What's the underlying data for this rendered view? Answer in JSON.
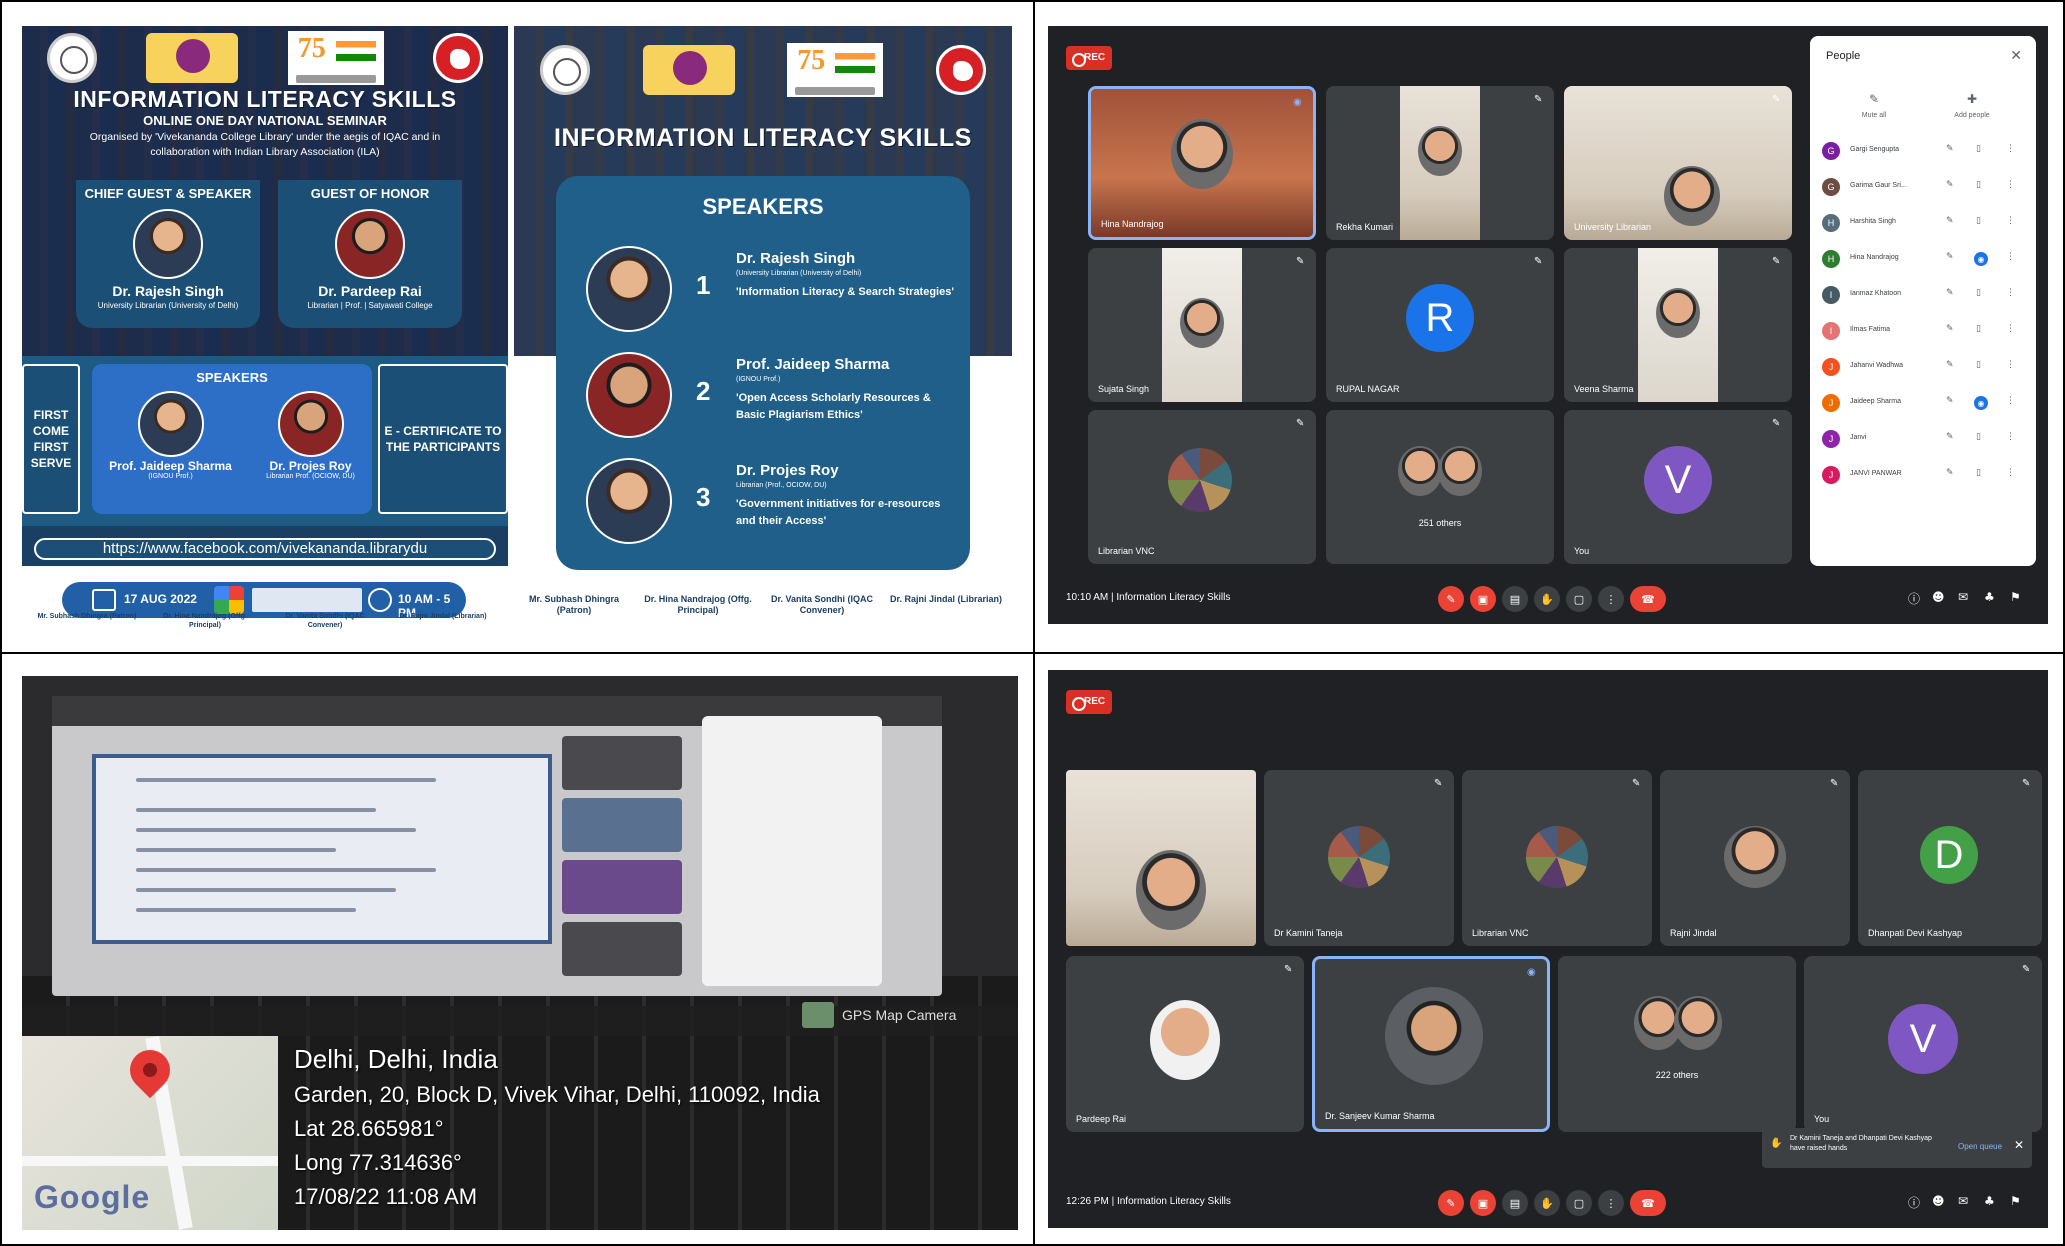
{
  "poster1": {
    "title": "INFORMATION LITERACY SKILLS",
    "subtitle": "ONLINE ONE DAY NATIONAL SEMINAR",
    "organised": "Organised by 'Vivekananda College Library' under the aegis of IQAC and in collaboration with Indian Library Association (ILA)",
    "chief_guest_heading": "CHIEF GUEST & SPEAKER",
    "chief_guest_name": "Dr. Rajesh Singh",
    "chief_guest_desc": "University Librarian (University of Delhi)",
    "guest_honor_heading": "GUEST OF HONOR",
    "guest_honor_name": "Dr. Pardeep Rai",
    "guest_honor_desc": "Librarian | Prof. | Satyawati College",
    "first_come": "FIRST COME FIRST SERVE",
    "speakers_heading": "SPEAKERS",
    "speaker1_name": "Prof. Jaideep Sharma",
    "speaker1_desc": "(IGNOU Prof.)",
    "speaker2_name": "Dr. Projes Roy",
    "speaker2_desc": "Librarian Prof. (OCIOW, DU)",
    "ecert": "E - CERTIFICATE TO THE PARTICIPANTS",
    "fb_link": "https://www.facebook.com/vivekananda.librarydu",
    "date": "17 AUG 2022",
    "time": "10 AM - 5 PM",
    "sign1": "Mr. Subhash Dhingra (Patron)",
    "sign2": "Dr. Hina Nandrajog (Offg. Principal)",
    "sign3": "Dr. Vanita Sondhi (IQAC Convener)",
    "sign4": "Dr. Rajni Jindal (Librarian)"
  },
  "poster2": {
    "title": "INFORMATION LITERACY SKILLS",
    "speakers_heading": "SPEAKERS",
    "speakers": [
      {
        "num": "1",
        "name": "Dr. Rajesh Singh",
        "desc": "(University Librarian (University of Delhi)",
        "topic": "'Information Literacy & Search Strategies'"
      },
      {
        "num": "2",
        "name": "Prof. Jaideep Sharma",
        "desc": "(IGNOU Prof.)",
        "topic": "'Open Access Scholarly Resources & Basic Plagiarism Ethics'"
      },
      {
        "num": "3",
        "name": "Dr. Projes Roy",
        "desc": "Librarian (Prof., OCIOW, DU)",
        "topic": "'Government initiatives for e-resources and their Access'"
      }
    ],
    "sign1": "Mr. Subhash Dhingra (Patron)",
    "sign2": "Dr. Hina Nandrajog (Offg. Principal)",
    "sign3": "Dr. Vanita Sondhi (IQAC Convener)",
    "sign4": "Dr. Rajni Jindal (Librarian)"
  },
  "meet1": {
    "rec": "REC",
    "tiles": [
      "Hina Nandrajog",
      "Rekha Kumari",
      "University Librarian",
      "Sujata Singh",
      "RUPAL NAGAR",
      "Veena Sharma",
      "Librarian VNC",
      "251 others",
      "You"
    ],
    "avatar_r": "R",
    "avatar_v": "V",
    "clock": "10:10 AM  |  Information Literacy Skills",
    "people": {
      "title": "People",
      "mute_all": "Mute all",
      "add_people": "Add people",
      "rows": [
        {
          "initial": "G",
          "name": "Gargi Sengupta",
          "color": "#7b1fa2"
        },
        {
          "initial": "G",
          "name": "Garima Gaur Sri...",
          "color": "#6d4c41"
        },
        {
          "initial": "H",
          "name": "Harshita Singh",
          "color": "#546e7a"
        },
        {
          "initial": "H",
          "name": "Hina Nandrajog",
          "color": "#2e7d32"
        },
        {
          "initial": "I",
          "name": "Ianmaz Khatoon",
          "color": "#455a64"
        },
        {
          "initial": "I",
          "name": "Ilmas Fatima",
          "color": "#e57373"
        },
        {
          "initial": "J",
          "name": "Jahanvi Wadhwa",
          "color": "#f4511e"
        },
        {
          "initial": "J",
          "name": "Jaideep Sharma",
          "color": "#ef6c00"
        },
        {
          "initial": "J",
          "name": "Janvi",
          "color": "#8e24aa"
        },
        {
          "initial": "J",
          "name": "JANVI PANWAR",
          "color": "#d81b60"
        }
      ]
    }
  },
  "meet2": {
    "rec": "REC",
    "tiles": [
      "Dr Kamini Taneja",
      "Librarian VNC",
      "Rajni Jindal",
      "Dhanpati Devi Kashyap",
      "Pardeep Rai",
      "Dr. Sanjeev Kumar Sharma",
      "222 others",
      "You"
    ],
    "avatar_d": "D",
    "avatar_v": "V",
    "clock": "12:26 PM  |  Information Literacy Skills",
    "hands_text": "Dr Kamini Taneja and Dhanpati Devi Kashyap have raised hands",
    "open_queue": "Open queue"
  },
  "photo": {
    "city": "Delhi, Delhi, India",
    "address": "Garden, 20, Block D, Vivek Vihar, Delhi, 110092, India",
    "lat": "Lat 28.665981°",
    "long": "Long 77.314636°",
    "datetime": "17/08/22 11:08 AM",
    "gps_camera": "GPS Map Camera",
    "google": "Google"
  },
  "colors": {
    "poster_navy": "#1b3f63",
    "poster_blue": "#1f5f8a",
    "meet_bg": "#202124",
    "meet_tile": "#3c4043",
    "rec_red": "#d93025",
    "avatar_blue": "#1a73e8",
    "avatar_purple": "#7e57c2",
    "avatar_green": "#43a047"
  }
}
